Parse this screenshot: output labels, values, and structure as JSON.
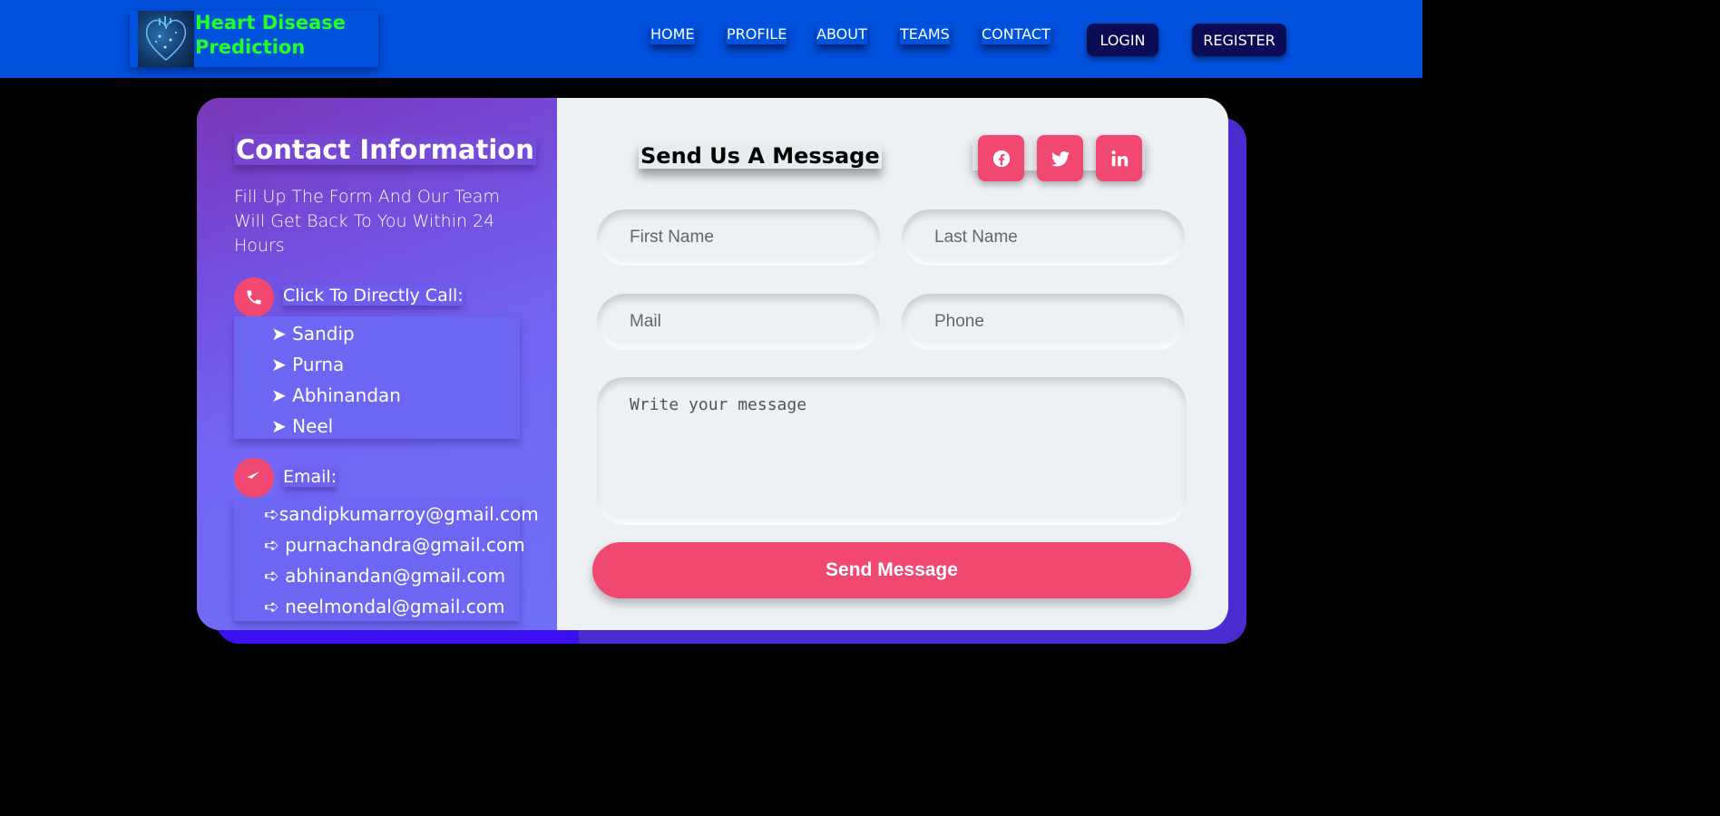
{
  "brand": {
    "title_line1": "Heart Disease",
    "title_line2": "Prediction",
    "title_color": "#22ff22"
  },
  "nav": {
    "links": [
      "HOME",
      "PROFILE",
      "ABOUT",
      "TEAMS",
      "CONTACT"
    ],
    "login": "LOGIN",
    "register": "REGISTER",
    "bar_color": "#0050dd",
    "button_color": "#0b0c55"
  },
  "contact_info": {
    "title": "Contact Information",
    "subtitle": "Fill Up The Form And Our Team Will Get Back To You Within 24 Hours",
    "call_label": "Click To Directly Call:",
    "call_icon": "phone-icon",
    "names": [
      "➤ Sandip",
      "➤ Purna",
      "➤ Abhinandan",
      "➤ Neel"
    ],
    "email_label": "Email:",
    "email_icon": "paper-plane-icon",
    "emails": [
      "➪sandipkumarroy@gmail.com",
      "➪ purnachandra@gmail.com",
      "➪ abhinandan@gmail.com",
      "➪ neelmondal@gmail.com"
    ]
  },
  "form": {
    "title": "Send Us A Message",
    "social": [
      "facebook-icon",
      "twitter-icon",
      "linkedin-icon"
    ],
    "first_name_placeholder": "First Name",
    "last_name_placeholder": "Last Name",
    "mail_placeholder": "Mail",
    "phone_placeholder": "Phone",
    "message_placeholder": "Write your message",
    "submit_label": "Send Message",
    "accent_color": "#f04870"
  }
}
